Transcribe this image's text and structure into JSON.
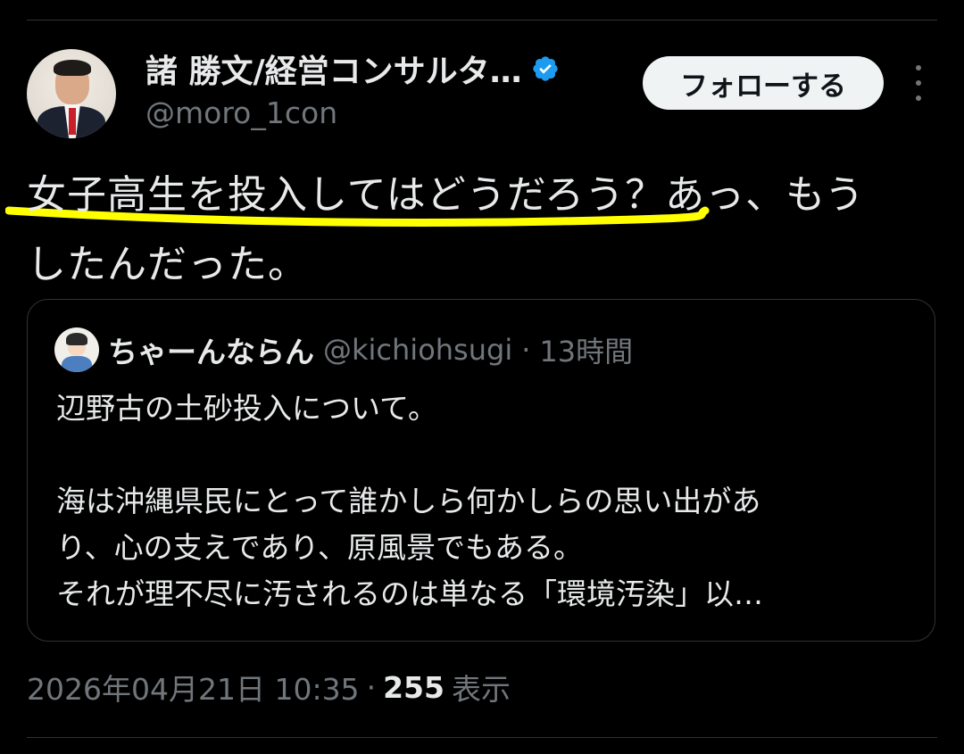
{
  "author": {
    "display_name": "諸 勝文/経営コンサルタ…",
    "handle": "@moro_1con",
    "verified_icon": "verified-badge-icon",
    "avatar_icon": "profile-photo"
  },
  "follow_button_label": "フォローする",
  "more_icon": "more-vertical-icon",
  "tweet": {
    "line1_highlighted": "女子高生を投入してはどうだろう？",
    "line1_rest": "あっ、もう",
    "line2": "したんだった。",
    "highlight_color": "#ffff00"
  },
  "quote": {
    "display_name": "ちゃーんならん",
    "handle": "@kichiohsugi",
    "separator": "·",
    "time": "13時間",
    "lines": [
      "辺野古の土砂投入について。",
      "",
      "海は沖縄県民にとって誰かしら何かしらの思い出があ",
      "り、心の支えであり、原風景でもある。",
      "それが理不尽に汚されるのは単なる「環境汚染」以…"
    ]
  },
  "meta": {
    "date": "2026年04月21日 10:35",
    "separator": "·",
    "views_count": "255",
    "views_label": "表示"
  },
  "colors": {
    "background": "#000000",
    "text": "#e7e9ea",
    "secondary": "#71767b",
    "border": "#2f3336",
    "verified": "#1d9bf0",
    "highlight": "#ffff00"
  }
}
